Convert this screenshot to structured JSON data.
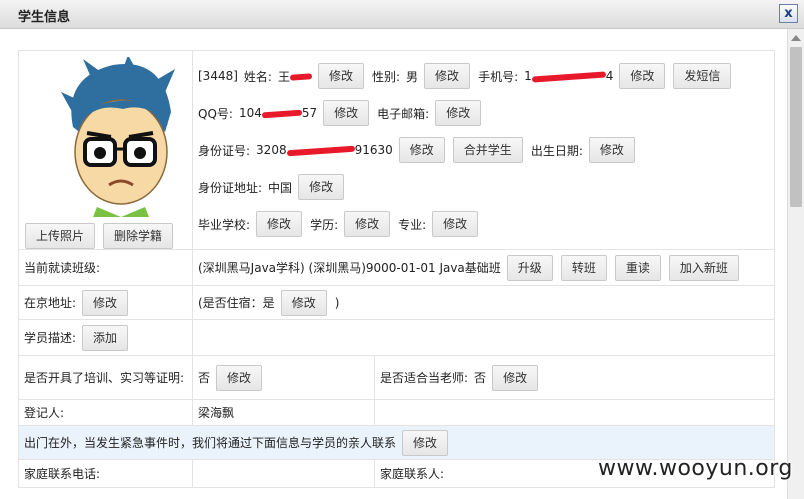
{
  "window": {
    "title": "学生信息",
    "close": "x"
  },
  "profile": {
    "id": "[3448]",
    "name_label": "姓名:",
    "name_value": "王",
    "gender_label": "性别:",
    "gender_value": "男",
    "phone_label": "手机号:",
    "phone_value": "1",
    "phone_value_tail": "4",
    "qq_label": "QQ号:",
    "qq_value": "104",
    "qq_value_tail": "57",
    "email_label": "电子邮箱:",
    "idcard_label": "身份证号:",
    "idcard_value": "3208",
    "idcard_value_tail": "91630",
    "birthday_label": "出生日期:",
    "idaddress_label": "身份证地址:",
    "idaddress_value": "中国",
    "school_label": "毕业学校:",
    "edu_label": "学历:",
    "major_label": "专业:"
  },
  "buttons": {
    "modify": "修改",
    "send_sms": "发短信",
    "merge": "合并学生",
    "upload_photo": "上传照片",
    "delete_record": "删除学籍",
    "upgrade": "升级",
    "transfer": "转班",
    "repeat": "重读",
    "join_new": "加入新班",
    "add": "添加"
  },
  "rows": {
    "current_class_label": "当前就读班级:",
    "current_class_value": "(深圳黑马Java学科) (深圳黑马)9000-01-01 Java基础班",
    "beijing_address_label": "在京地址:",
    "dorm_text_pre": "(是否住宿：是",
    "dorm_text_post": ")",
    "description_label": "学员描述:",
    "certificate_label": "是否开具了培训、实习等证明:",
    "certificate_value": "否",
    "teacher_label": "是否适合当老师:",
    "teacher_value": "否",
    "registrar_label": "登记人:",
    "registrar_value": "梁海飘",
    "emergency_text": "出门在外，当发生紧急事件时，我们将通过下面信息与学员的亲人联系",
    "family_phone_label": "家庭联系电话:",
    "family_contact_label": "家庭联系人:"
  },
  "watermark": "www.wooyun.org",
  "colors": {
    "redaction": "#e8192b",
    "highlight_row": "#eaf3fb"
  }
}
